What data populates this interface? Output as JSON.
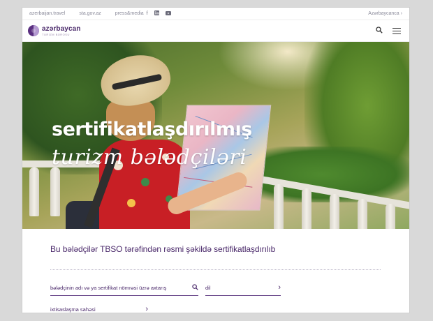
{
  "topbar": {
    "links": [
      "azerbaijan.travel",
      "sta.gov.az",
      "press&media"
    ],
    "social_icons": [
      "facebook-icon",
      "linkedin-icon",
      "youtube-icon"
    ],
    "language": "Azərbaycanca",
    "language_chevron": "›"
  },
  "header": {
    "logo_name": "azərbaycan",
    "logo_subtitle": "TURİZM BÜROSU",
    "search_icon": "search-icon",
    "menu_icon": "hamburger-icon"
  },
  "hero": {
    "title": "sertifikatlaşdırılmış",
    "subtitle": "turizm bələdçiləri"
  },
  "search": {
    "section_title": "Bu bələdçilər TBSO tərəfindən rəsmi şəkildə sertifikatlaşdırılıb",
    "search_placeholder": "bələdçinin adı və ya sertifikat nömrəsi üzrə axtarış",
    "language_label": "dil",
    "specialization_label": "ixtisaslaşma sahəsi",
    "chevron": "›"
  },
  "colors": {
    "brand_purple": "#4b2a6b",
    "accent_purple": "#7b4fa3"
  }
}
